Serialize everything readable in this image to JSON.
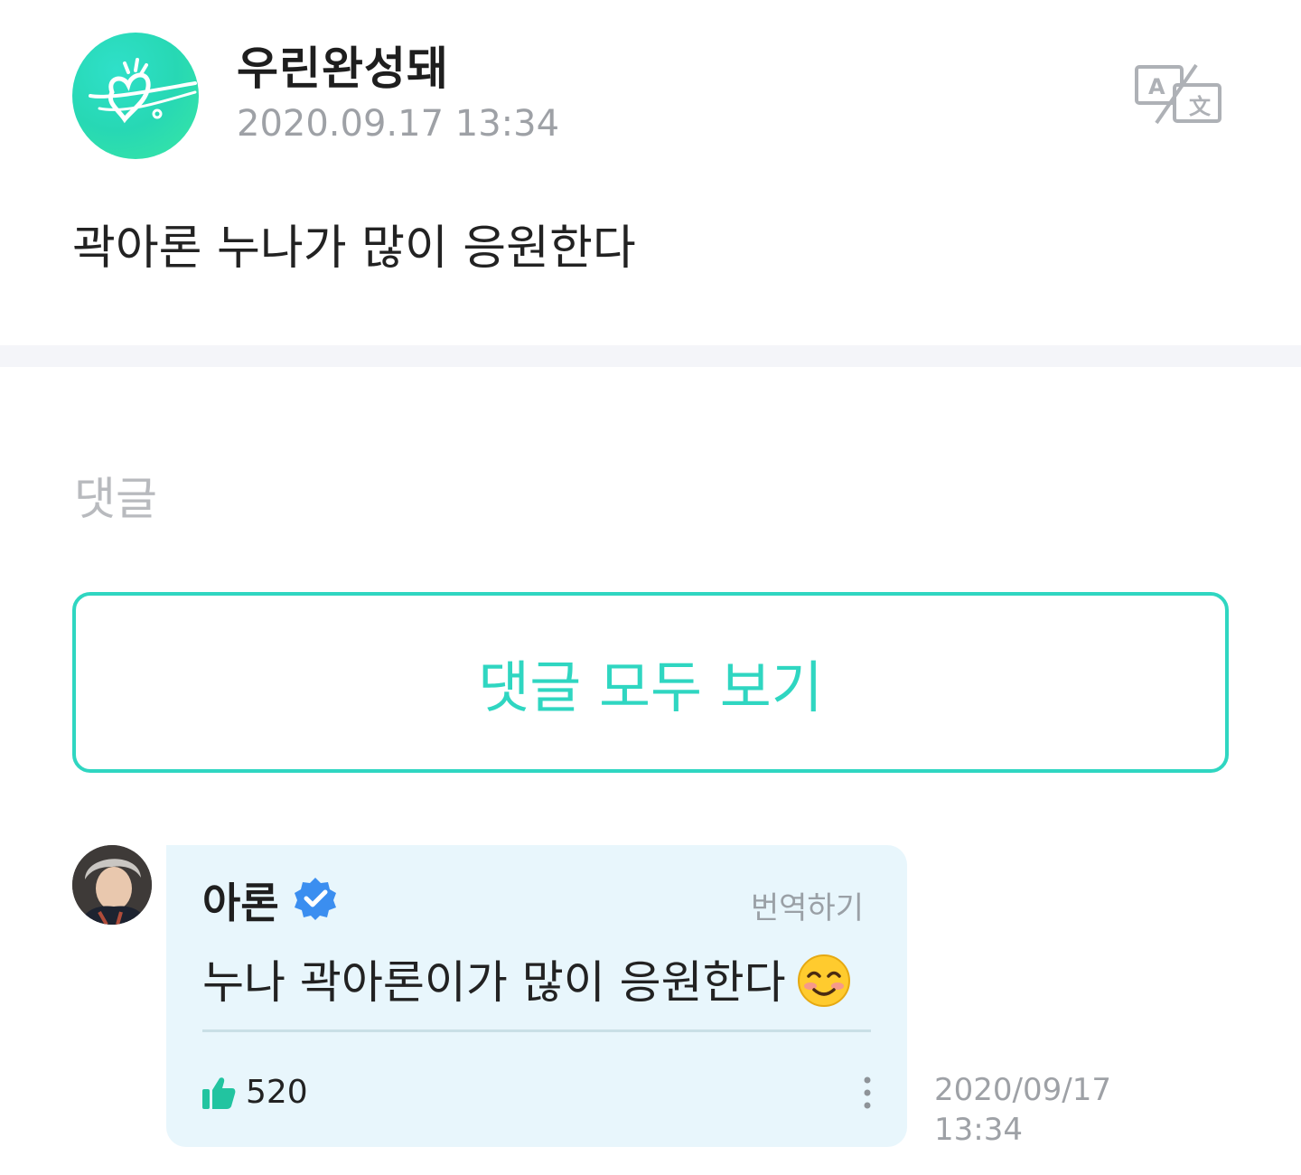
{
  "post": {
    "author_name": "우린완성돼",
    "date": "2020.09.17 13:34",
    "body": "곽아론 누나가 많이 응원한다",
    "translate_icon": "translate-icon"
  },
  "comments": {
    "title": "댓글",
    "view_all_label": "댓글 모두 보기"
  },
  "comment": {
    "name": "아론",
    "translate_label": "번역하기",
    "text": "누나 곽아론이가 많이 응원한다",
    "likes": "520",
    "date_line1": "2020/09/17",
    "date_line2": "13:34"
  },
  "colors": {
    "accent": "#2fd6c1",
    "card_bg": "#e8f6fc",
    "verified": "#3b8ef0",
    "like": "#22c4a0"
  }
}
